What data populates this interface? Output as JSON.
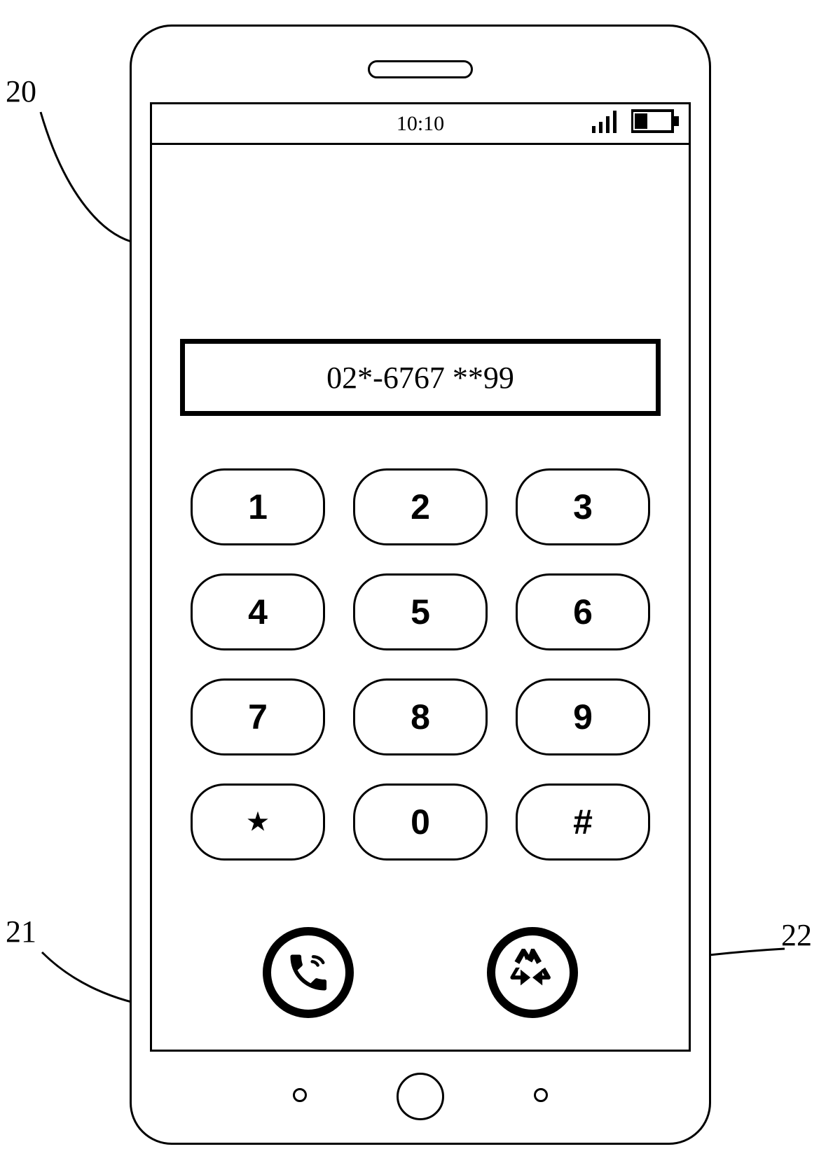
{
  "callouts": {
    "c20": "20",
    "c21": "21",
    "c22": "22"
  },
  "status": {
    "time": "10:10"
  },
  "dialer": {
    "entered_number": "02*-6767 **99"
  },
  "keypad": {
    "k1": "1",
    "k2": "2",
    "k3": "3",
    "k4": "4",
    "k5": "5",
    "k6": "6",
    "k7": "7",
    "k8": "8",
    "k9": "9",
    "kstar": "★",
    "k0": "0",
    "khash": "#"
  }
}
